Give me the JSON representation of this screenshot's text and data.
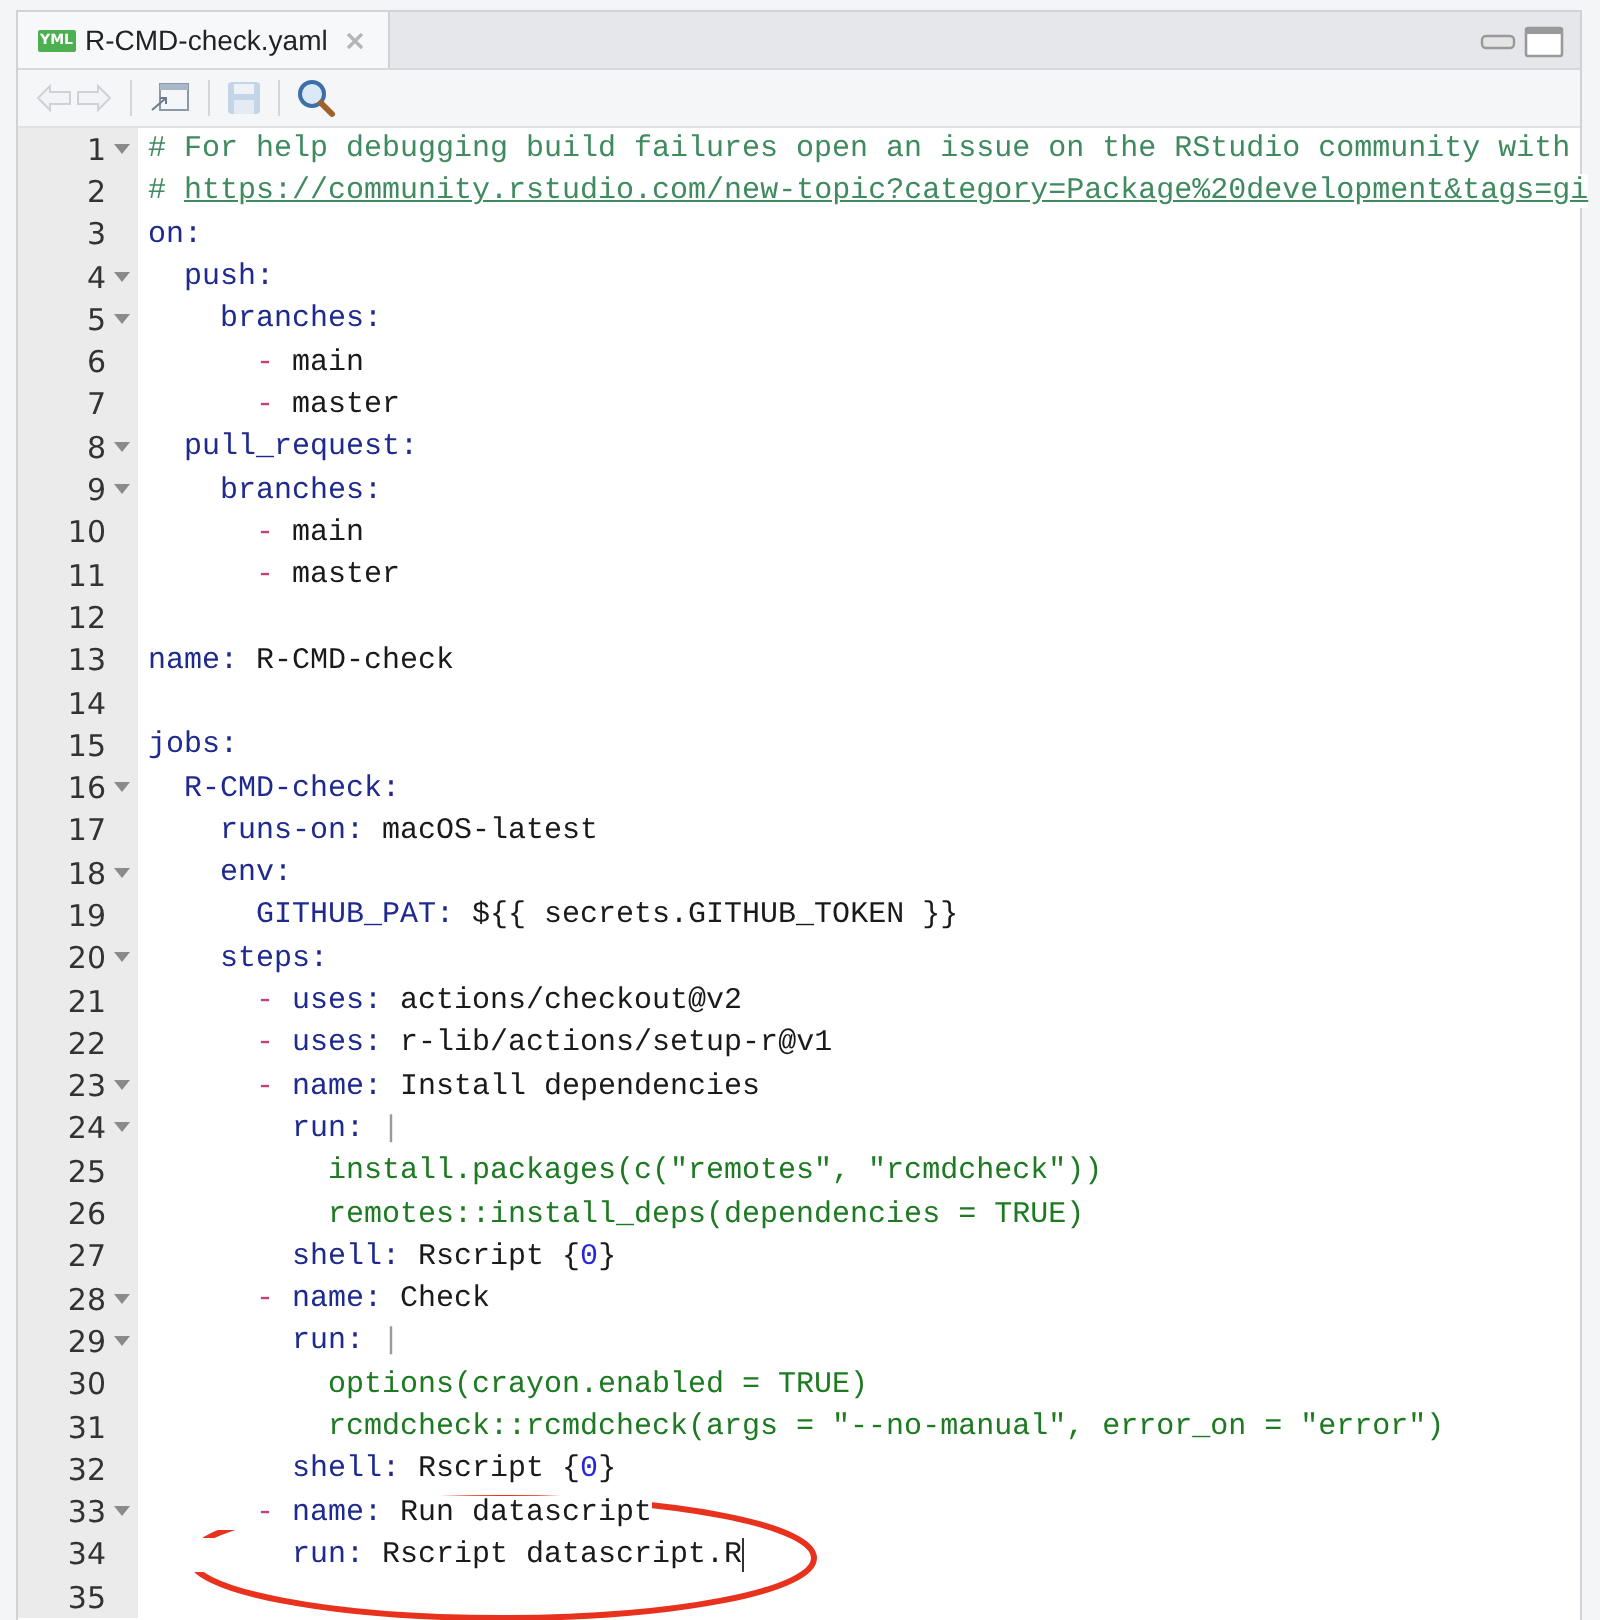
{
  "tab": {
    "badge": "YML",
    "title": "R-CMD-check.yaml",
    "selected": true
  },
  "toolbar": {
    "back_disabled": true,
    "save_disabled": true
  },
  "lines": [
    {
      "number": "1",
      "fold": true,
      "tokens": [
        {
          "kind": "comment",
          "text": "# For help debugging build failures open an issue on the RStudio community with"
        }
      ]
    },
    {
      "number": "2",
      "fold": false,
      "tokens": [
        {
          "kind": "comment",
          "text": "# "
        },
        {
          "kind": "link",
          "text": "https://community.rstudio.com/new-topic?category=Package%20development&tags=gi"
        }
      ]
    },
    {
      "number": "3",
      "fold": false,
      "tokens": [
        {
          "kind": "key",
          "text": "on:"
        }
      ]
    },
    {
      "number": "4",
      "fold": true,
      "tokens": [
        {
          "kind": "key",
          "text": "  push:"
        }
      ]
    },
    {
      "number": "5",
      "fold": true,
      "tokens": [
        {
          "kind": "key",
          "text": "    branches:"
        }
      ]
    },
    {
      "number": "6",
      "fold": false,
      "tokens": [
        {
          "kind": "dash",
          "text": "      -"
        },
        {
          "kind": "plain",
          "text": " main"
        }
      ]
    },
    {
      "number": "7",
      "fold": false,
      "tokens": [
        {
          "kind": "dash",
          "text": "      -"
        },
        {
          "kind": "plain",
          "text": " master"
        }
      ]
    },
    {
      "number": "8",
      "fold": true,
      "tokens": [
        {
          "kind": "key",
          "text": "  pull_request:"
        }
      ]
    },
    {
      "number": "9",
      "fold": true,
      "tokens": [
        {
          "kind": "key",
          "text": "    branches:"
        }
      ]
    },
    {
      "number": "10",
      "fold": false,
      "tokens": [
        {
          "kind": "dash",
          "text": "      -"
        },
        {
          "kind": "plain",
          "text": " main"
        }
      ]
    },
    {
      "number": "11",
      "fold": false,
      "tokens": [
        {
          "kind": "dash",
          "text": "      -"
        },
        {
          "kind": "plain",
          "text": " master"
        }
      ]
    },
    {
      "number": "12",
      "fold": false
    },
    {
      "number": "13",
      "fold": false,
      "tokens": [
        {
          "kind": "key",
          "text": "name:"
        },
        {
          "kind": "plain",
          "text": " R-CMD-check"
        }
      ]
    },
    {
      "number": "14",
      "fold": false
    },
    {
      "number": "15",
      "fold": false,
      "tokens": [
        {
          "kind": "key",
          "text": "jobs:"
        }
      ]
    },
    {
      "number": "16",
      "fold": true,
      "tokens": [
        {
          "kind": "key",
          "text": "  R-CMD-check:"
        }
      ]
    },
    {
      "number": "17",
      "fold": false,
      "tokens": [
        {
          "kind": "key",
          "text": "    runs-on:"
        },
        {
          "kind": "plain",
          "text": " macOS-latest"
        }
      ]
    },
    {
      "number": "18",
      "fold": true,
      "tokens": [
        {
          "kind": "key",
          "text": "    env:"
        }
      ]
    },
    {
      "number": "19",
      "fold": false,
      "tokens": [
        {
          "kind": "key",
          "text": "      GITHUB_PAT:"
        },
        {
          "kind": "plain",
          "text": " ${{ secrets.GITHUB_TOKEN }}"
        }
      ]
    },
    {
      "number": "20",
      "fold": true,
      "tokens": [
        {
          "kind": "key",
          "text": "    steps:"
        }
      ]
    },
    {
      "number": "21",
      "fold": false,
      "tokens": [
        {
          "kind": "dash",
          "text": "      -"
        },
        {
          "kind": "key",
          "text": " uses:"
        },
        {
          "kind": "plain",
          "text": " actions/checkout@v2"
        }
      ]
    },
    {
      "number": "22",
      "fold": false,
      "tokens": [
        {
          "kind": "dash",
          "text": "      -"
        },
        {
          "kind": "key",
          "text": " uses:"
        },
        {
          "kind": "plain",
          "text": " r-lib/actions/setup-r@v1"
        }
      ]
    },
    {
      "number": "23",
      "fold": true,
      "tokens": [
        {
          "kind": "dash",
          "text": "      -"
        },
        {
          "kind": "key",
          "text": " name:"
        },
        {
          "kind": "plain",
          "text": " Install dependencies"
        }
      ]
    },
    {
      "number": "24",
      "fold": true,
      "tokens": [
        {
          "kind": "key",
          "text": "        run:"
        },
        {
          "kind": "operator",
          "text": " |"
        }
      ]
    },
    {
      "number": "25",
      "fold": false,
      "tokens": [
        {
          "kind": "string",
          "text": "          install.packages(c(\"remotes\", \"rcmdcheck\"))"
        }
      ]
    },
    {
      "number": "26",
      "fold": false,
      "tokens": [
        {
          "kind": "string",
          "text": "          remotes::install_deps(dependencies = TRUE)"
        }
      ]
    },
    {
      "number": "27",
      "fold": false,
      "tokens": [
        {
          "kind": "key",
          "text": "        shell:"
        },
        {
          "kind": "plain",
          "text": " Rscript {"
        },
        {
          "kind": "number",
          "text": "0"
        },
        {
          "kind": "plain",
          "text": "}"
        }
      ]
    },
    {
      "number": "28",
      "fold": true,
      "tokens": [
        {
          "kind": "dash",
          "text": "      -"
        },
        {
          "kind": "key",
          "text": " name:"
        },
        {
          "kind": "plain",
          "text": " Check"
        }
      ]
    },
    {
      "number": "29",
      "fold": true,
      "tokens": [
        {
          "kind": "key",
          "text": "        run:"
        },
        {
          "kind": "operator",
          "text": " |"
        }
      ]
    },
    {
      "number": "30",
      "fold": false,
      "tokens": [
        {
          "kind": "string",
          "text": "          options(crayon.enabled = TRUE)"
        }
      ]
    },
    {
      "number": "31",
      "fold": false,
      "tokens": [
        {
          "kind": "string",
          "text": "          rcmdcheck::rcmdcheck(args = \"--no-manual\", error_on = \"error\")"
        }
      ]
    },
    {
      "number": "32",
      "fold": false,
      "tokens": [
        {
          "kind": "key",
          "text": "        shell:"
        },
        {
          "kind": "plain",
          "text": " Rscript {"
        },
        {
          "kind": "number",
          "text": "0"
        },
        {
          "kind": "plain",
          "text": "}"
        }
      ]
    },
    {
      "number": "33",
      "fold": true,
      "tokens": [
        {
          "kind": "dash",
          "text": "      -"
        },
        {
          "kind": "key",
          "text": " name:"
        },
        {
          "kind": "plain",
          "text": " Run datascript"
        }
      ]
    },
    {
      "number": "34",
      "fold": false,
      "cursor": true,
      "tokens": [
        {
          "kind": "key",
          "text": "        run:"
        },
        {
          "kind": "plain",
          "text": " Rscript datascript.R"
        }
      ]
    },
    {
      "number": "35",
      "fold": false
    }
  ],
  "annotation": {
    "kind": "ellipse",
    "color": "#e8321e"
  }
}
